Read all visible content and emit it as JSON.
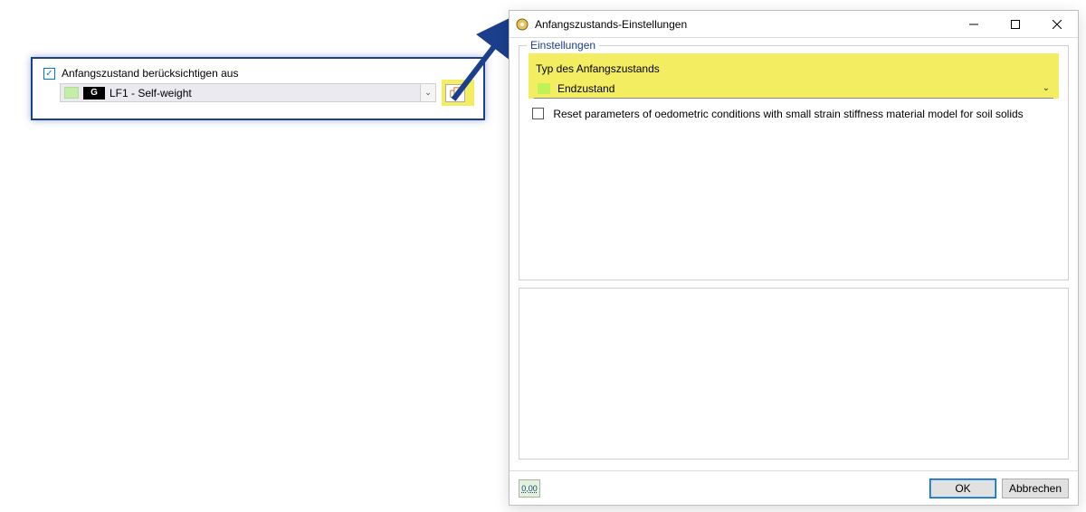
{
  "left": {
    "checkbox_label": "Anfangszustand berücksichtigen aus",
    "checkbox_checked": true,
    "selected_value": "LF1 - Self-weight",
    "badge": "G"
  },
  "dialog": {
    "title": "Anfangszustands-Einstellungen",
    "group_title": "Einstellungen",
    "type_label": "Typ des Anfangszustands",
    "type_value": "Endzustand",
    "reset_checkbox_label": "Reset parameters of oedometric conditions with small strain stiffness material model for soil solids",
    "footer_value": "0,00",
    "ok": "OK",
    "cancel": "Abbrechen"
  }
}
